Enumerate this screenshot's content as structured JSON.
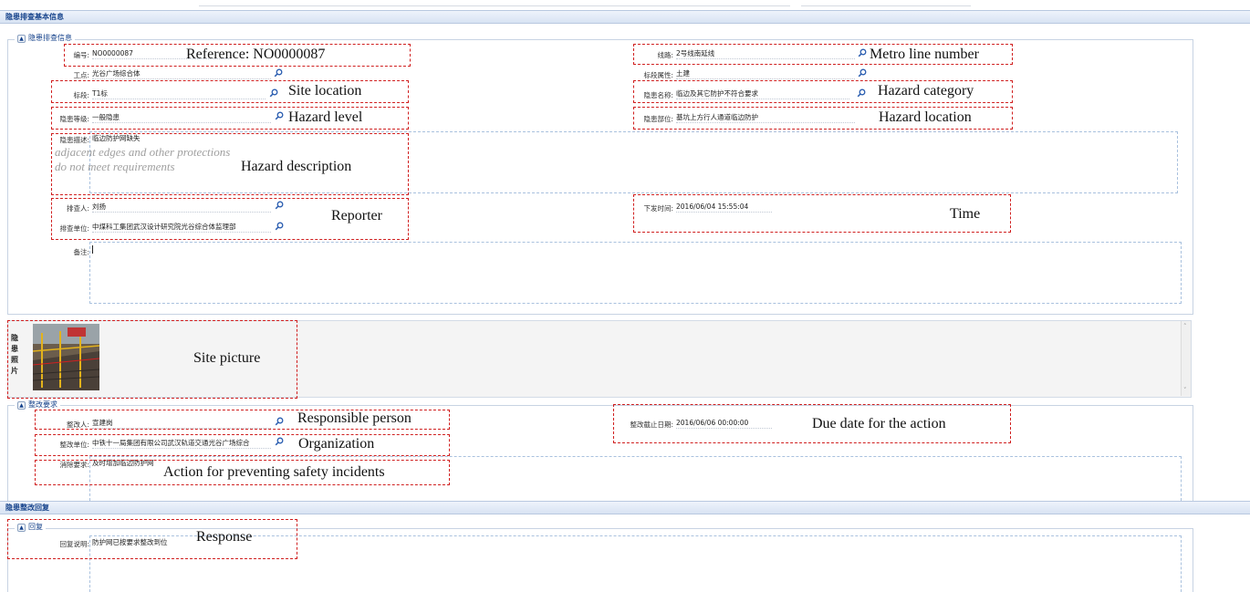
{
  "sections": {
    "basic_info_header": "隐患排查基本信息",
    "inspection_legend": "隐患排查信息",
    "rectify_legend": "整改要求",
    "reply_header": "隐患整改回复",
    "reply_legend": "回复"
  },
  "fields": {
    "ref_label": "编号:",
    "ref_value": "NO0000087",
    "line_label": "线路:",
    "line_value": "2号线南延线",
    "site_label": "工点:",
    "site_value": "光谷广场综合体",
    "section_attr_label": "标段属性:",
    "section_attr_value": "土建",
    "lot_label": "标段:",
    "lot_value": "T1标",
    "hazard_name_label": "隐患名称:",
    "hazard_name_value": "临边及其它防护不符合要求",
    "hazard_level_label": "隐患等级:",
    "hazard_level_value": "一般隐患",
    "hazard_part_label": "隐患部位:",
    "hazard_part_value": "基坑上方行人通道临边防护",
    "desc_label": "隐患描述:",
    "desc_value": "临边防护网缺失",
    "reporter_label": "排查人:",
    "reporter_value": "刘扬",
    "issue_time_label": "下发时间:",
    "issue_time_value": "2016/06/04 15:55:04",
    "reporter_unit_label": "排查单位:",
    "reporter_unit_value": "中煤科工集团武汉设计研究院光谷综合体监理部",
    "remark_label": "备注:",
    "photo_label": [
      "隐",
      "患",
      "照",
      "片"
    ],
    "rect_person_label": "整改人:",
    "rect_person_value": "宣建岗",
    "deadline_label": "整改截止日期:",
    "deadline_value": "2016/06/06 00:00:00",
    "rect_unit_label": "整改单位:",
    "rect_unit_value": "中铁十一局集团有限公司武汉轨道交通光谷广场综合",
    "elim_label": "消除要求:",
    "elim_value": "及时增加临边防护网",
    "reply_label": "回复说明:",
    "reply_value": "防护网已按要求整改到位"
  },
  "annotations": {
    "reference": "Reference: NO0000087",
    "metro_line": "Metro line number",
    "site_location": "Site location",
    "hazard_category": "Hazard category",
    "hazard_level": "Hazard level",
    "hazard_location": "Hazard location",
    "hazard_description": "Hazard description",
    "desc_translation_1": "adjacent edges and other protections",
    "desc_translation_2": "do not meet requirements",
    "reporter": "Reporter",
    "time": "Time",
    "site_picture": "Site picture",
    "responsible_person": "Responsible person",
    "due_date": "Due date for the action",
    "organization": "Organization",
    "action": "Action for preventing safety incidents",
    "response": "Response"
  },
  "colors": {
    "annotation_border": "#d01f1f",
    "header_text": "#15428b"
  }
}
